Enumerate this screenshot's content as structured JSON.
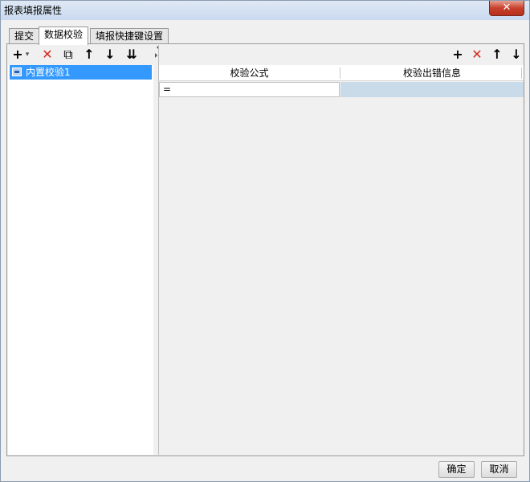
{
  "window": {
    "title": "报表填报属性",
    "close_glyph": "✕"
  },
  "tabs": [
    {
      "label": "提交",
      "active": false
    },
    {
      "label": "数据校验",
      "active": true
    },
    {
      "label": "填报快捷键设置",
      "active": false
    }
  ],
  "left_toolbar": {
    "add_glyph": "+",
    "add_dropdown_glyph": "▾",
    "delete_glyph": "✕",
    "copy_glyph": "⧉",
    "up_glyph": "↑",
    "down_glyph": "↓",
    "move_bottom_glyph": "⇊"
  },
  "validation_list": {
    "items": [
      {
        "label": "内置校验1",
        "selected": true
      }
    ]
  },
  "right_toolbar": {
    "add_glyph": "+",
    "delete_glyph": "✕",
    "up_glyph": "↑",
    "down_glyph": "↓"
  },
  "grid": {
    "columns": [
      "校验公式",
      "校验出错信息"
    ],
    "rows": [
      {
        "formula": "=",
        "message": ""
      }
    ]
  },
  "footer": {
    "ok_label": "确定",
    "cancel_label": "取消"
  },
  "colors": {
    "selection": "#3399ff",
    "delete_red": "#d22a1e",
    "message_cell": "#c9dbe8"
  }
}
